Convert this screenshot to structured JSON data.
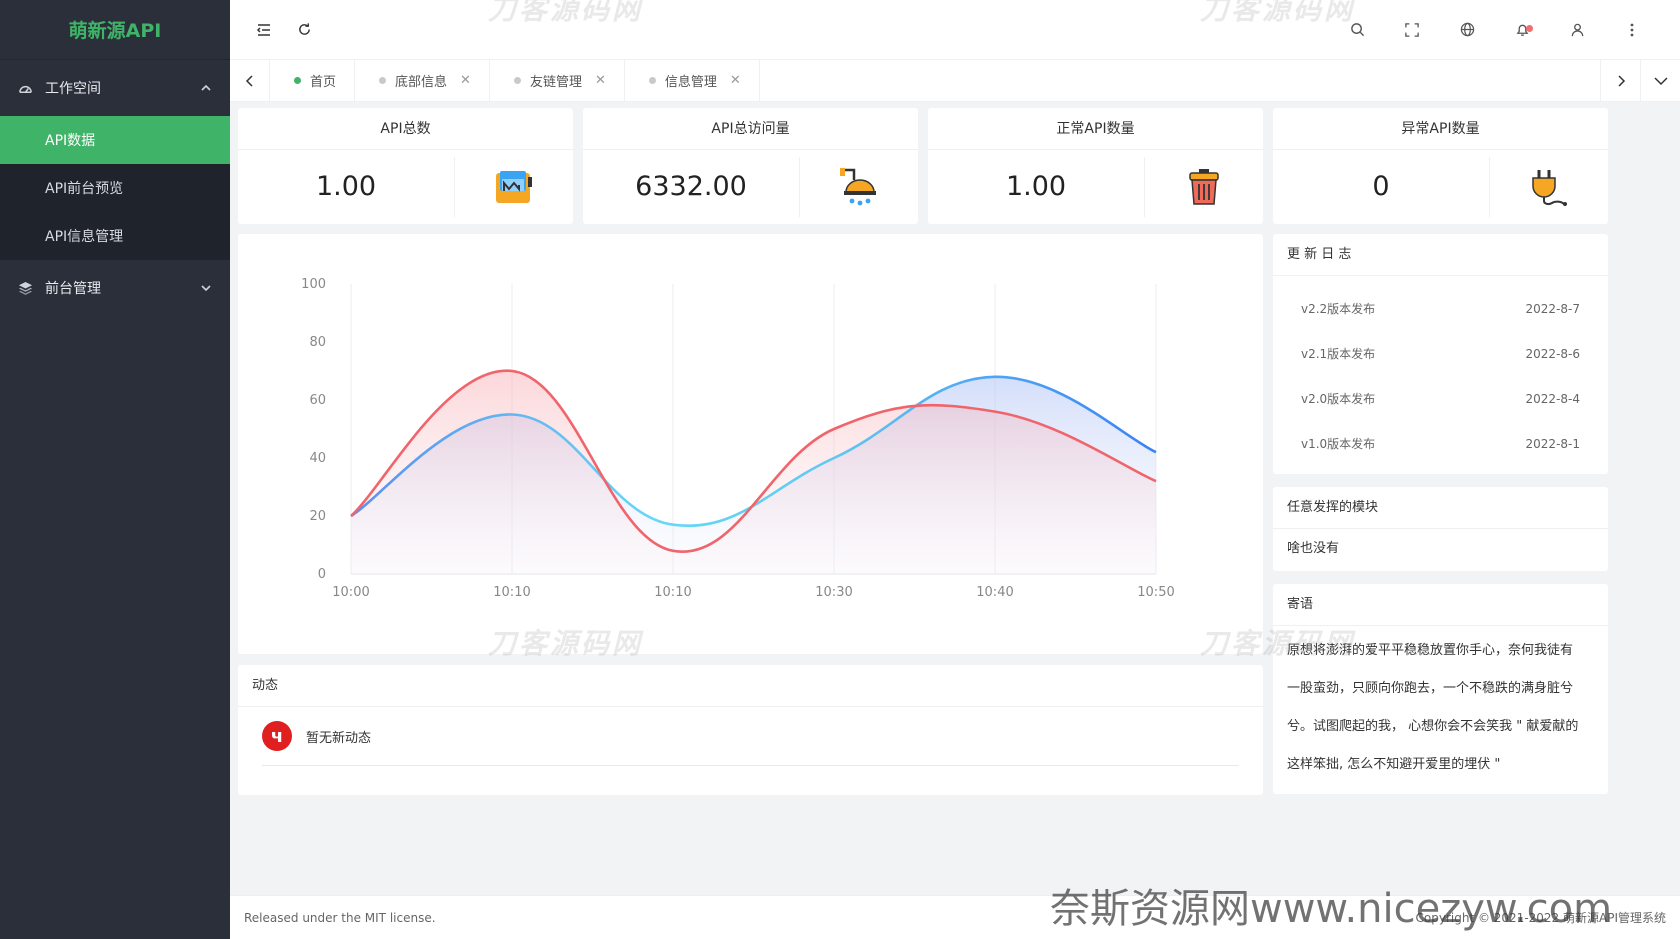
{
  "app": {
    "title": "萌新源API"
  },
  "sidebar": {
    "groups": [
      {
        "label": "工作空间",
        "icon": "dashboard-icon",
        "expanded": true,
        "items": [
          {
            "label": "API数据",
            "active": true
          },
          {
            "label": "API前台预览",
            "active": false
          },
          {
            "label": "API信息管理",
            "active": false
          }
        ]
      },
      {
        "label": "前台管理",
        "icon": "layers-icon",
        "expanded": false,
        "items": []
      }
    ]
  },
  "header": {
    "left_icons": [
      "menu-fold-icon",
      "refresh-icon"
    ],
    "right_icons": [
      "search-icon",
      "fullscreen-icon",
      "globe-icon",
      "bell-icon",
      "user-icon",
      "more-vertical-icon"
    ]
  },
  "tabs": [
    {
      "label": "首页",
      "active": true,
      "closable": false
    },
    {
      "label": "底部信息",
      "active": false,
      "closable": true
    },
    {
      "label": "友链管理",
      "active": false,
      "closable": true
    },
    {
      "label": "信息管理",
      "active": false,
      "closable": true
    }
  ],
  "stats": [
    {
      "title": "API总数",
      "value": "1.00",
      "icon": "paint-bucket-icon"
    },
    {
      "title": "API总访问量",
      "value": "6332.00",
      "icon": "shower-icon"
    },
    {
      "title": "正常API数量",
      "value": "1.00",
      "icon": "trash-can-icon"
    },
    {
      "title": "异常API数量",
      "value": "0",
      "icon": "plug-icon"
    }
  ],
  "chart_data": {
    "type": "area",
    "x": [
      "10:00",
      "10:10",
      "10:10",
      "10:30",
      "10:40",
      "10:50"
    ],
    "ylim": [
      0,
      100
    ],
    "yticks": [
      0,
      20,
      40,
      60,
      80,
      100
    ],
    "grid": "vertical",
    "series": [
      {
        "values": [
          20,
          55,
          17,
          40,
          68,
          42
        ],
        "color": "#3b82f6"
      },
      {
        "values": [
          20,
          70,
          8,
          50,
          56,
          32
        ],
        "color": "#f0646c"
      }
    ]
  },
  "changelog": {
    "title": "更 新 日 志",
    "items": [
      {
        "label": "v2.2版本发布",
        "date": "2022-8-7"
      },
      {
        "label": "v2.1版本发布",
        "date": "2022-8-6"
      },
      {
        "label": "v2.0版本发布",
        "date": "2022-8-4"
      },
      {
        "label": "v1.0版本发布",
        "date": "2022-8-1"
      }
    ]
  },
  "module_panel": {
    "title": "任意发挥的模块",
    "content": "啥也没有"
  },
  "message_panel": {
    "title": "寄语",
    "lines": [
      "原想将澎湃的爱平平稳稳放置你手心，奈何我徒有",
      "一股蛮劲，只顾向你跑去，一个不稳跌的满身脏兮",
      "兮。试图爬起的我， 心想你会不会笑我 \" 献爱献的",
      "这样笨拙, 怎么不知避开爱里的埋伏 \""
    ]
  },
  "activity": {
    "title": "动态",
    "avatar_letter": "ч",
    "empty_text": "暂无新动态"
  },
  "footer": {
    "left": "Released under the MIT license.",
    "right": "Copyright © 2021-2022 萌新源API管理系统"
  },
  "watermarks": {
    "brand": "刀客源码网",
    "site": "奈斯资源网www.nicezyw.com"
  },
  "colors": {
    "accent": "#3fb468",
    "sidebar_bg": "#2a2f3a",
    "sidebar_sub_bg": "#1f232b",
    "badge": "#f56c6c"
  }
}
